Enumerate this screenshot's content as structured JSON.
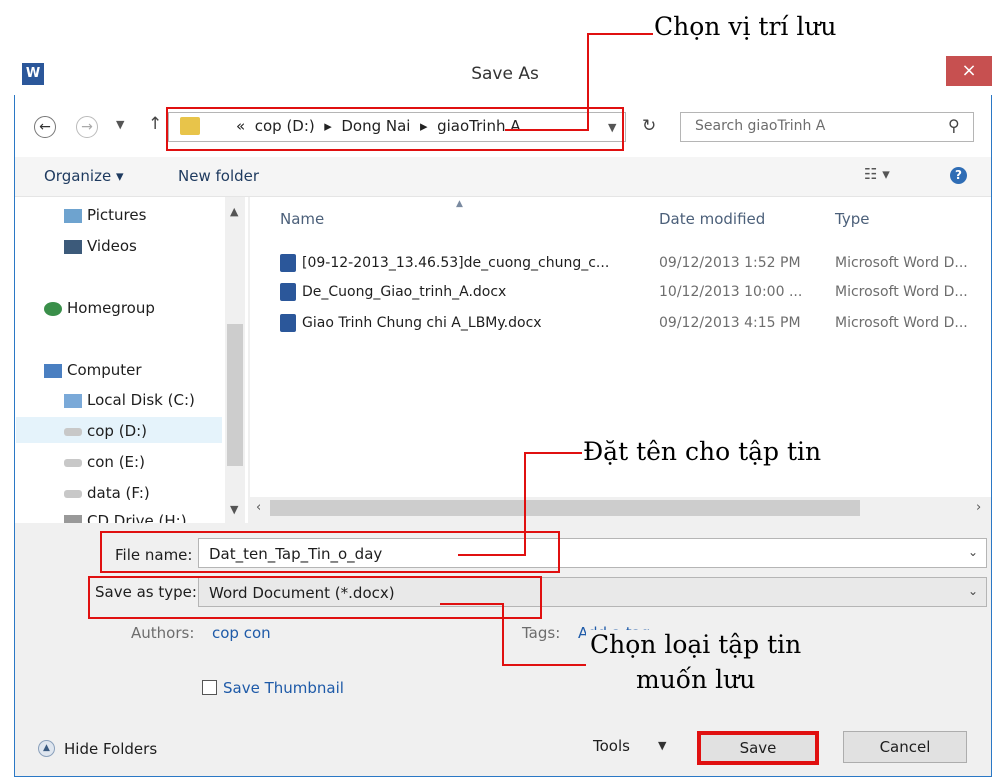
{
  "annotations": {
    "choose_location": "Chọn vị trí lưu",
    "name_file": "Đặt tên cho tập tin",
    "choose_type_line1": "Chọn loại tập tin",
    "choose_type_line2": "muốn lưu"
  },
  "window": {
    "title": "Save As",
    "app_icon": "W",
    "close": "×"
  },
  "nav": {
    "breadcrumb_prefix": "«",
    "breadcrumb": [
      "cop (D:)",
      "Dong Nai",
      "giaoTrinh A"
    ],
    "search_placeholder": "Search giaoTrinh A"
  },
  "toolbar": {
    "organize": "Organize ▾",
    "new_folder": "New folder"
  },
  "sidebar": {
    "items": [
      {
        "label": "Pictures"
      },
      {
        "label": "Videos"
      },
      {
        "label": "Homegroup"
      },
      {
        "label": "Computer"
      },
      {
        "label": "Local Disk (C:)"
      },
      {
        "label": "cop (D:)"
      },
      {
        "label": "con (E:)"
      },
      {
        "label": "data (F:)"
      },
      {
        "label": "CD Drive (H:)"
      }
    ]
  },
  "files": {
    "columns": {
      "name": "Name",
      "date": "Date modified",
      "type": "Type"
    },
    "rows": [
      {
        "name": "[09-12-2013_13.46.53]de_cuong_chung_c...",
        "date": "09/12/2013 1:52 PM",
        "type": "Microsoft Word D..."
      },
      {
        "name": "De_Cuong_Giao_trinh_A.docx",
        "date": "10/12/2013 10:00 ...",
        "type": "Microsoft Word D..."
      },
      {
        "name": "Giao Trinh Chung chi A_LBMy.docx",
        "date": "09/12/2013 4:15 PM",
        "type": "Microsoft Word D..."
      }
    ]
  },
  "form": {
    "file_name_label": "File name:",
    "file_name_value": "Dat_ten_Tap_Tin_o_day",
    "type_label": "Save as type:",
    "type_value": "Word Document (*.docx)",
    "authors_label": "Authors:",
    "authors_value": "cop con",
    "tags_label": "Tags:",
    "tags_value": "Add a tag",
    "thumbnail_label": "Save Thumbnail"
  },
  "footer": {
    "hide_folders": "Hide Folders",
    "tools": "Tools",
    "save": "Save",
    "cancel": "Cancel"
  }
}
